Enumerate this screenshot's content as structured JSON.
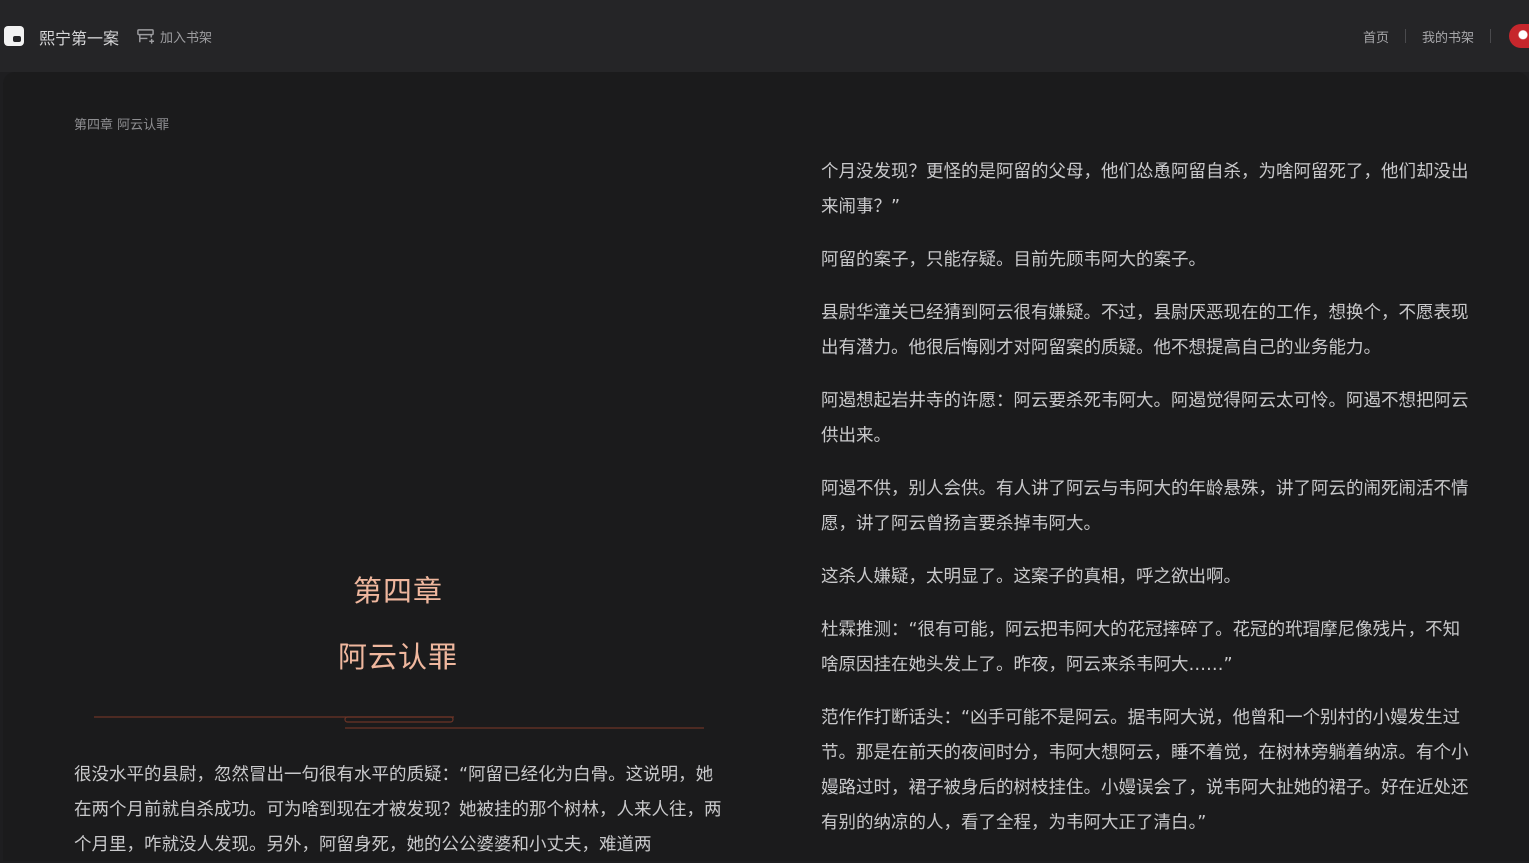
{
  "header": {
    "book_title": "熙宁第一案",
    "add_shelf_label": "加入书架",
    "nav": [
      "首页",
      "我的书架"
    ]
  },
  "chapter": {
    "breadcrumb": "第四章 阿云认罪",
    "number": "第四章",
    "name": "阿云认罪"
  },
  "left_page": {
    "paragraph": "很没水平的县尉，忽然冒出一句很有水平的质疑：“阿留已经化为白骨。这说明，她在两个月前就自杀成功。可为啥到现在才被发现？她被挂的那个树林，人来人往，两个月里，咋就没人发现。另外，阿留身死，她的公公婆婆和小丈夫，难道两"
  },
  "right_page": {
    "paragraphs": [
      "个月没发现？更怪的是阿留的父母，他们怂恿阿留自杀，为啥阿留死了，他们却没出来闹事？”",
      "阿留的案子，只能存疑。目前先顾韦阿大的案子。",
      "县尉华潼关已经猜到阿云很有嫌疑。不过，县尉厌恶现在的工作，想换个，不愿表现出有潜力。他很后悔刚才对阿留案的质疑。他不想提高自己的业务能力。",
      "阿遏想起岩井寺的许愿：阿云要杀死韦阿大。阿遏觉得阿云太可怜。阿遏不想把阿云供出来。",
      "阿遏不供，别人会供。有人讲了阿云与韦阿大的年龄悬殊，讲了阿云的闹死闹活不情愿，讲了阿云曾扬言要杀掉韦阿大。",
      "这杀人嫌疑，太明显了。这案子的真相，呼之欲出啊。",
      "杜霖推测：“很有可能，阿云把韦阿大的花冠摔碎了。花冠的玳瑁摩尼像残片，不知啥原因挂在她头发上了。昨夜，阿云来杀韦阿大……”",
      "范作作打断话头：“凶手可能不是阿云。据韦阿大说，他曾和一个别村的小嫚发生过节。那是在前天的夜间时分，韦阿大想阿云，睡不着觉，在树林旁躺着纳凉。有个小嫚路过时，裙子被身后的树枝挂住。小嫚误会了，说韦阿大扯她的裙子。好在近处还有别的纳凉的人，看了全程，为韦阿大正了清白。”"
    ]
  },
  "colors": {
    "background": "#1b1b1c",
    "topbar": "#252527",
    "text": "#c9c9cb",
    "chapter_title": "#efb79e",
    "ornament": "#6b3427"
  },
  "icons": {
    "logo": "book-logo-icon",
    "add_shelf": "bookshelf-add-icon",
    "avatar": "user-avatar"
  }
}
